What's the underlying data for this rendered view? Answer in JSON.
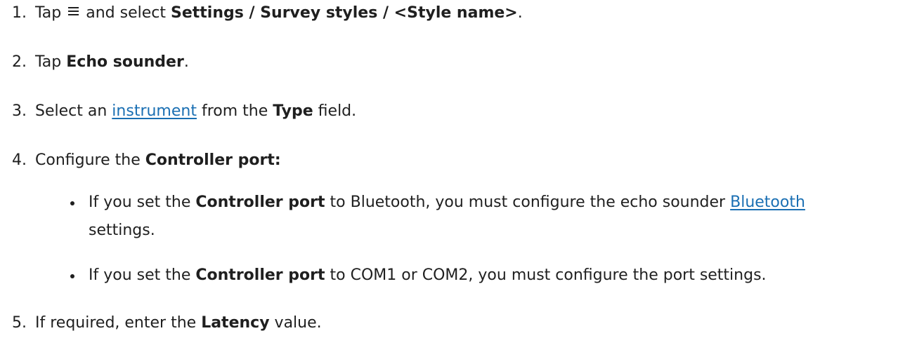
{
  "steps": [
    {
      "number": "1.",
      "pre": "Tap",
      "icon": "menu-icon",
      "mid": "and select",
      "bold": "Settings / Survey styles / <Style name>",
      "post": "."
    },
    {
      "number": "2.",
      "pre": "Tap",
      "bold": "Echo sounder",
      "post": "."
    },
    {
      "number": "3.",
      "pre": "Select an",
      "link": "instrument",
      "mid": "from the",
      "bold": "Type",
      "post": "field."
    },
    {
      "number": "4.",
      "pre": "Configure the",
      "bold": "Controller port:"
    },
    {
      "number": "5.",
      "pre": "If required, enter the",
      "bold": "Latency",
      "post": "value."
    }
  ],
  "bullets": [
    {
      "pre": "If you set the",
      "bold": "Controller port",
      "mid": "to Bluetooth, you must configure the echo sounder",
      "link": "Bluetooth",
      "post": "settings."
    },
    {
      "pre": "If you set the",
      "bold": "Controller port",
      "post": "to COM1 or COM2, you must configure the port settings."
    }
  ],
  "colors": {
    "text": "#1f1f1f",
    "link": "#1a6fb3",
    "background": "#ffffff"
  }
}
